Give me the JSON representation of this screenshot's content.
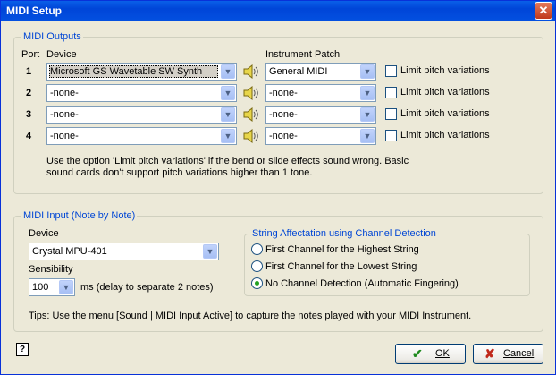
{
  "window": {
    "title": "MIDI Setup",
    "close_glyph": "✕"
  },
  "outputs": {
    "title": "MIDI Outputs",
    "col_port": "Port",
    "col_device": "Device",
    "col_patch": "Instrument Patch",
    "rows": [
      {
        "port": "1",
        "device": "Microsoft GS Wavetable SW Synth",
        "patch": "General MIDI",
        "limit": "Limit pitch variations",
        "checked": false
      },
      {
        "port": "2",
        "device": "-none-",
        "patch": "-none-",
        "limit": "Limit pitch variations",
        "checked": false
      },
      {
        "port": "3",
        "device": "-none-",
        "patch": "-none-",
        "limit": "Limit pitch variations",
        "checked": false
      },
      {
        "port": "4",
        "device": "-none-",
        "patch": "-none-",
        "limit": "Limit pitch variations",
        "checked": false
      }
    ],
    "note_line1": "Use the option 'Limit pitch variations' if the bend or slide effects sound wrong. Basic",
    "note_line2": "sound cards don't support pitch variations higher than 1 tone."
  },
  "input": {
    "title": "MIDI Input (Note by Note)",
    "device_label": "Device",
    "device_value": "Crystal MPU-401",
    "sensibility_label": "Sensibility",
    "sensibility_value": "100",
    "ms_text": "ms  (delay to separate 2 notes)",
    "channel_group": {
      "title": "String Affectation using Channel Detection",
      "options": [
        {
          "label": "First Channel for the Highest String",
          "selected": false
        },
        {
          "label": "First Channel for the Lowest String",
          "selected": false
        },
        {
          "label": "No Channel Detection (Automatic Fingering)",
          "selected": true
        }
      ]
    },
    "tips": "Tips: Use the menu [Sound | MIDI Input Active] to capture the notes played with your MIDI Instrument."
  },
  "footer": {
    "help_glyph": "?",
    "ok_label": "OK",
    "ok_icon": "✔",
    "cancel_label": "Cancel",
    "cancel_icon": "✘"
  },
  "colors": {
    "group_title": "#0046D5",
    "ok_icon": "#1E8A1E",
    "cancel_icon": "#C0281B"
  }
}
